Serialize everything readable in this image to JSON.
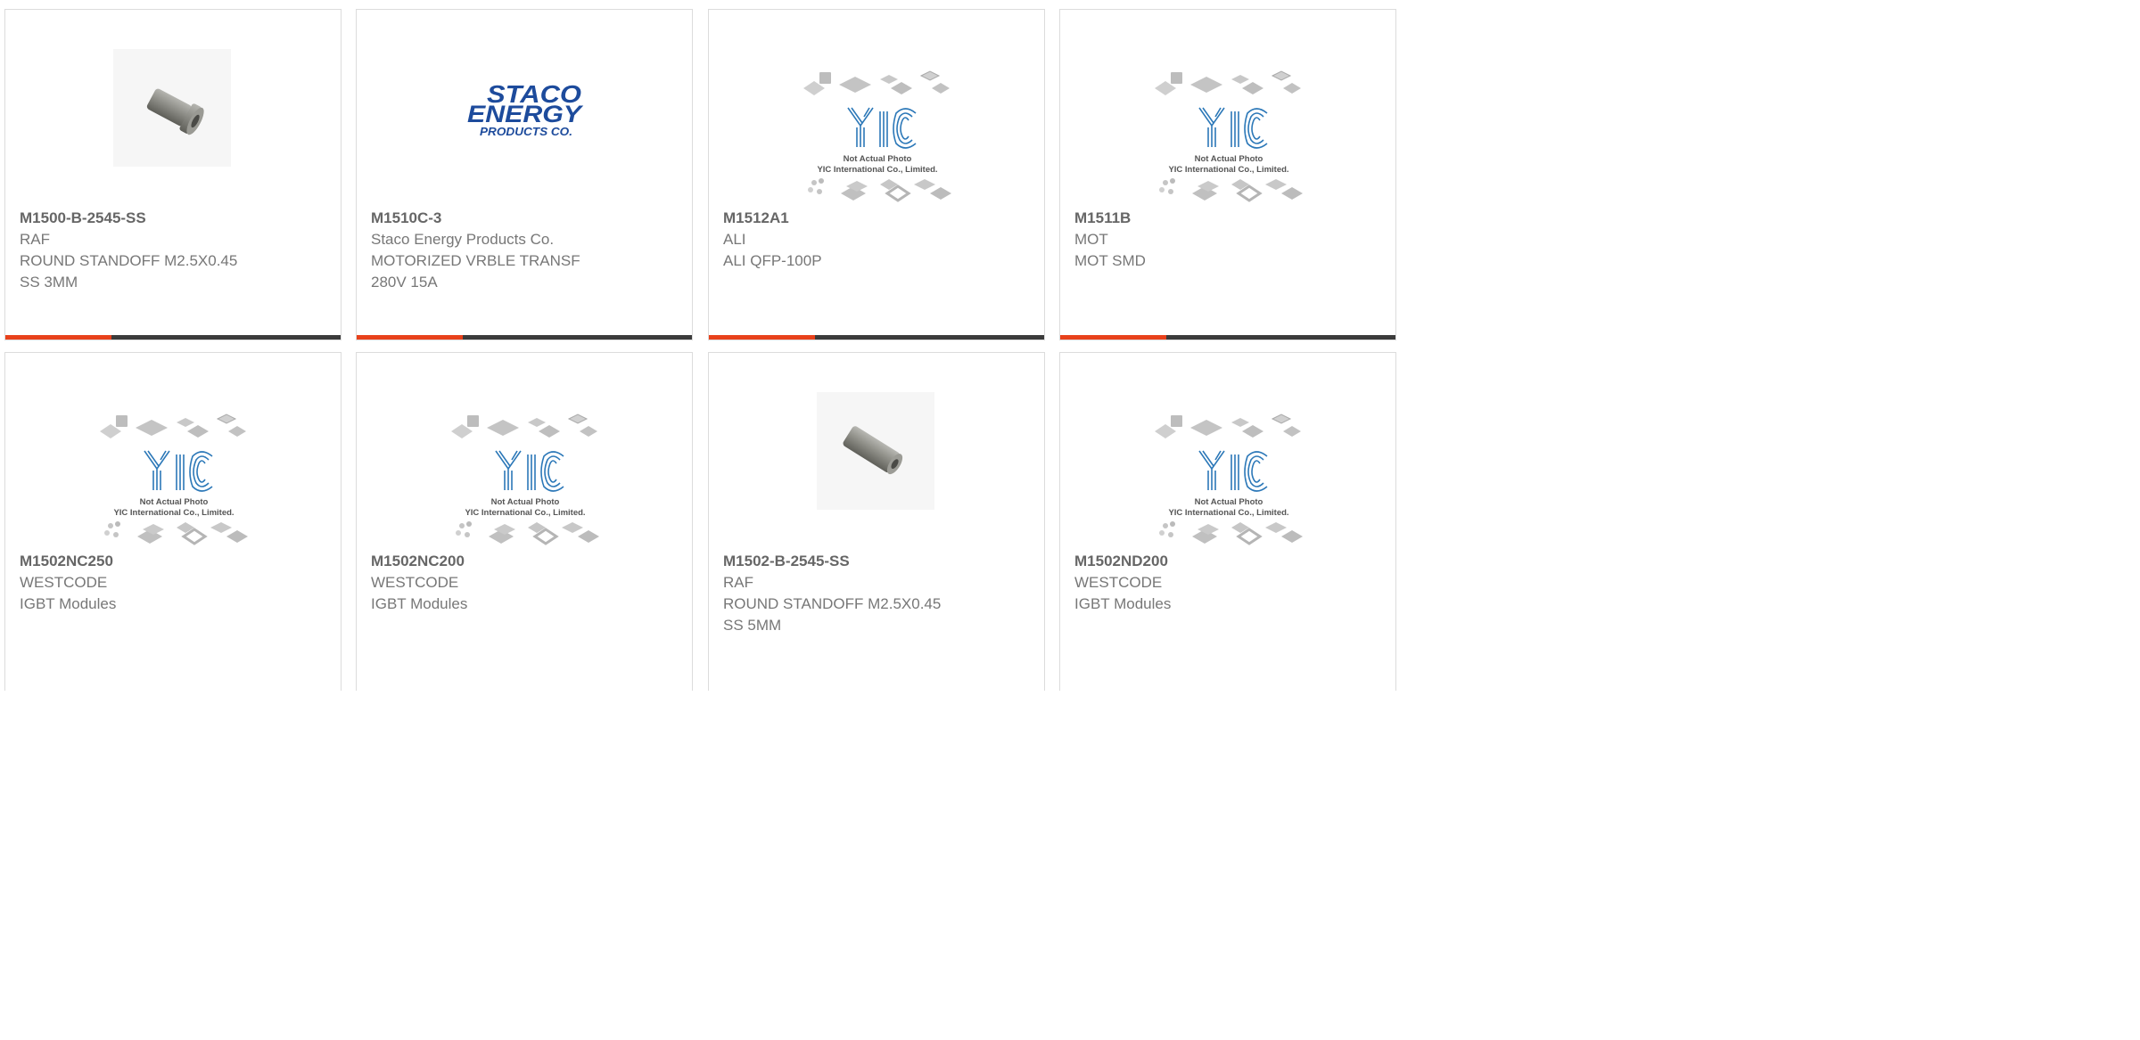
{
  "theme": {
    "accent_color": "#e8411b",
    "bar_color": "#3b3b3b"
  },
  "placeholder_image": {
    "line1": "Not Actual Photo",
    "line2": "YIC International Co., Limited.",
    "logo_text": "YIC"
  },
  "brand_logos": {
    "staco": {
      "line1": "STACO",
      "line2": "ENERGY",
      "line3": "PRODUCTS CO."
    }
  },
  "products": [
    {
      "part_number": "M1500-B-2545-SS",
      "manufacturer": "RAF",
      "description_lines": [
        "ROUND STANDOFF M2.5X0.45",
        "SS 3MM"
      ],
      "image": "standoff-photo"
    },
    {
      "part_number": "M1510C-3",
      "manufacturer": "Staco Energy Products Co.",
      "description_lines": [
        "MOTORIZED VRBLE TRANSF",
        "280V 15A"
      ],
      "image": "staco-logo"
    },
    {
      "part_number": "M1512A1",
      "manufacturer": "ALI",
      "description_lines": [
        "ALI QFP-100P"
      ],
      "image": "yic-placeholder"
    },
    {
      "part_number": "M1511B",
      "manufacturer": "MOT",
      "description_lines": [
        "MOT SMD"
      ],
      "image": "yic-placeholder"
    },
    {
      "part_number": "M1502NC250",
      "manufacturer": "WESTCODE",
      "description_lines": [
        "IGBT Modules"
      ],
      "image": "yic-placeholder"
    },
    {
      "part_number": "M1502NC200",
      "manufacturer": "WESTCODE",
      "description_lines": [
        "IGBT Modules"
      ],
      "image": "yic-placeholder"
    },
    {
      "part_number": "M1502-B-2545-SS",
      "manufacturer": "RAF",
      "description_lines": [
        "ROUND STANDOFF M2.5X0.45",
        "SS 5MM"
      ],
      "image": "standoff-photo"
    },
    {
      "part_number": "M1502ND200",
      "manufacturer": "WESTCODE",
      "description_lines": [
        "IGBT Modules"
      ],
      "image": "yic-placeholder"
    }
  ]
}
